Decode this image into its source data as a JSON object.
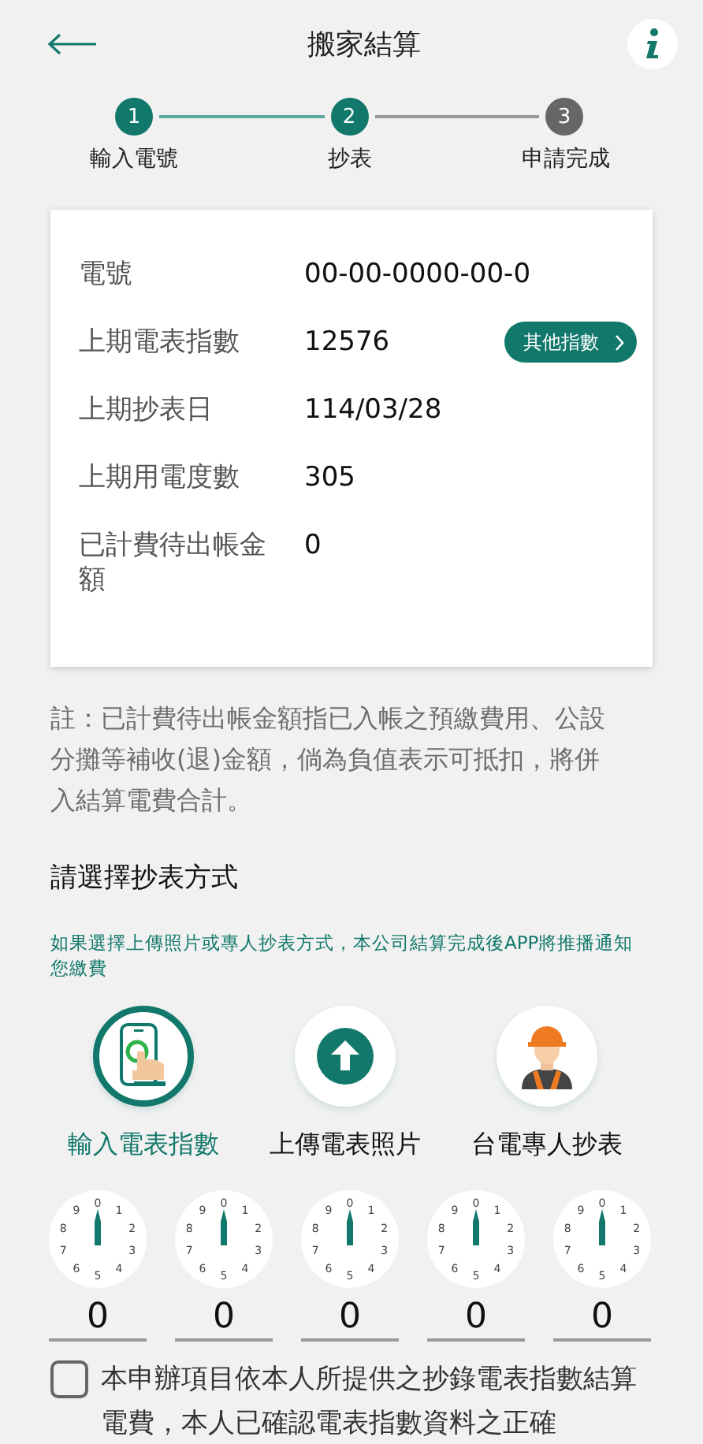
{
  "header": {
    "title": "搬家結算"
  },
  "steps": [
    {
      "number": "1",
      "label": "輸入電號",
      "reached": true
    },
    {
      "number": "2",
      "label": "抄表",
      "reached": true
    },
    {
      "number": "3",
      "label": "申請完成",
      "reached": false
    }
  ],
  "account": {
    "rows": [
      {
        "label": "電號",
        "value": "00-00-0000-00-0"
      },
      {
        "label": "上期電表指數",
        "value": "12576",
        "action": "其他指數"
      },
      {
        "label": "上期抄表日",
        "value": "114/03/28"
      },
      {
        "label": "上期用電度數",
        "value": "305"
      },
      {
        "label": "已計費待出帳金額",
        "value": "0"
      }
    ]
  },
  "note": "註：已計費待出帳金額指已入帳之預繳費用、公設分攤等補收(退)金額，倘為負值表示可抵扣，將併入結算電費合計。",
  "reading_method": {
    "heading": "請選擇抄表方式",
    "hint": "如果選擇上傳照片或專人抄表方式，本公司結算完成後APP將推播通知您繳費",
    "options": [
      {
        "kind": "keypad",
        "label": "輸入電表指數",
        "selected": true
      },
      {
        "kind": "upload",
        "label": "上傳電表照片",
        "selected": false
      },
      {
        "kind": "technician",
        "label": "台電專人抄表",
        "selected": false
      }
    ]
  },
  "dials": [
    {
      "face": [
        "0",
        "1",
        "2",
        "3",
        "4",
        "5",
        "6",
        "7",
        "8",
        "9"
      ],
      "value": "0"
    },
    {
      "face": [
        "0",
        "1",
        "2",
        "3",
        "4",
        "5",
        "6",
        "7",
        "8",
        "9"
      ],
      "value": "0"
    },
    {
      "face": [
        "0",
        "1",
        "2",
        "3",
        "4",
        "5",
        "6",
        "7",
        "8",
        "9"
      ],
      "value": "0"
    },
    {
      "face": [
        "0",
        "1",
        "2",
        "3",
        "4",
        "5",
        "6",
        "7",
        "8",
        "9"
      ],
      "value": "0"
    },
    {
      "face": [
        "0",
        "1",
        "2",
        "3",
        "4",
        "5",
        "6",
        "7",
        "8",
        "9"
      ],
      "value": "0"
    }
  ],
  "agreement": {
    "checked": false,
    "text": "本申辦項目依本人所提供之抄錄電表指數結算電費，本人已確認電表指數資料之正確"
  }
}
